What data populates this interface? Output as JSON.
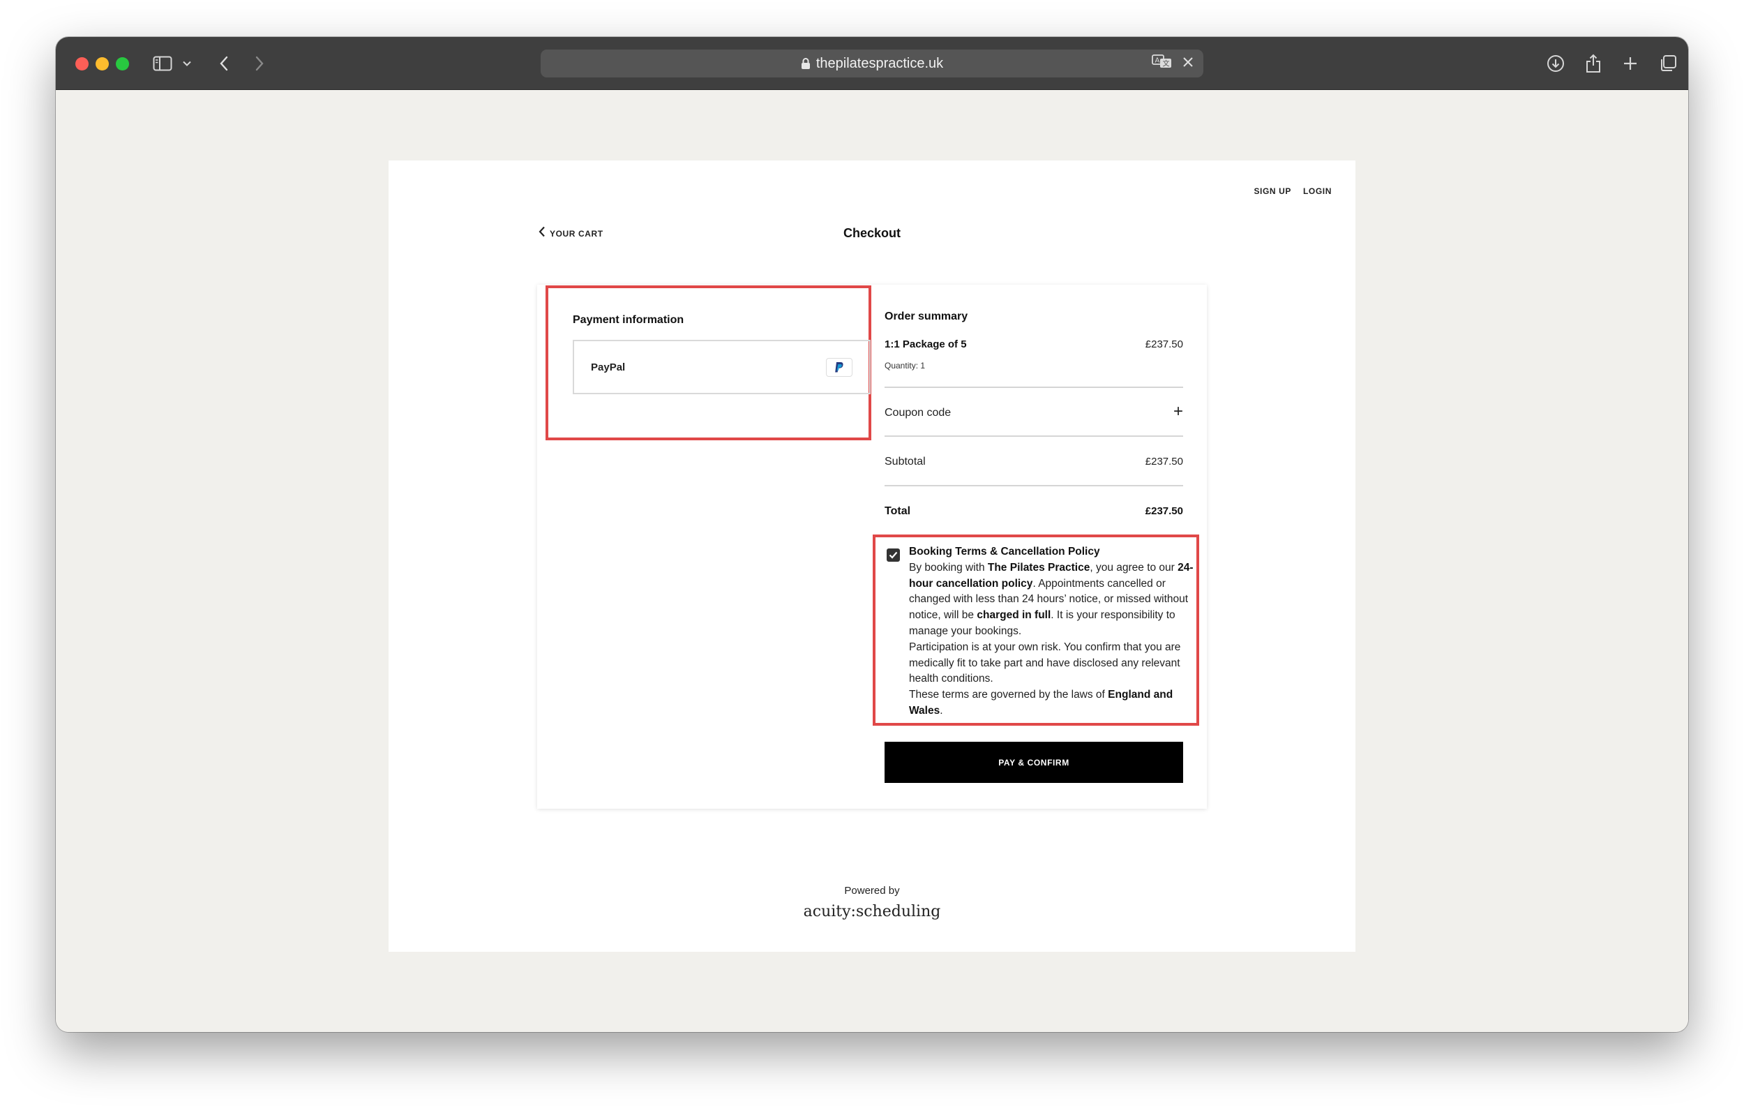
{
  "browser": {
    "url": "thepilatespractice.uk"
  },
  "header": {
    "sign_up": "SIGN UP",
    "login": "LOGIN",
    "back_label": "YOUR CART",
    "title": "Checkout"
  },
  "payment": {
    "title": "Payment information",
    "method_label": "PayPal",
    "method_icon": "paypal-icon"
  },
  "summary": {
    "title": "Order summary",
    "item_name": "1:1 Package of 5",
    "item_price": "£237.50",
    "item_quantity": "Quantity: 1",
    "coupon_label": "Coupon code",
    "subtotal_label": "Subtotal",
    "subtotal_value": "£237.50",
    "total_label": "Total",
    "total_value": "£237.50"
  },
  "terms": {
    "checked": true,
    "title": "Booking Terms & Cancellation Policy",
    "p1_pre": "By booking with ",
    "p1_business": "The Pilates Practice",
    "p1_mid": ", you agree to our ",
    "p1_policy": "24-hour cancellation policy",
    "p1_rest": ". Appointments cancelled or changed with less than 24 hours’ notice, or missed without notice, will be ",
    "p1_charged": "charged in full",
    "p1_end": ". It is your responsibility to manage your bookings.",
    "p2": "Participation is at your own risk. You confirm that you are medically fit to take part and have disclosed any relevant health conditions.",
    "p3_pre": "These terms are governed by the laws of ",
    "p3_law": "England and Wales",
    "p3_end": "."
  },
  "actions": {
    "pay_button": "PAY & CONFIRM"
  },
  "footer": {
    "powered_by": "Powered by",
    "brand": "acuity:scheduling"
  },
  "colors": {
    "highlight": "#e04848",
    "button_bg": "#000000",
    "page_bg": "#f1f0ec"
  }
}
